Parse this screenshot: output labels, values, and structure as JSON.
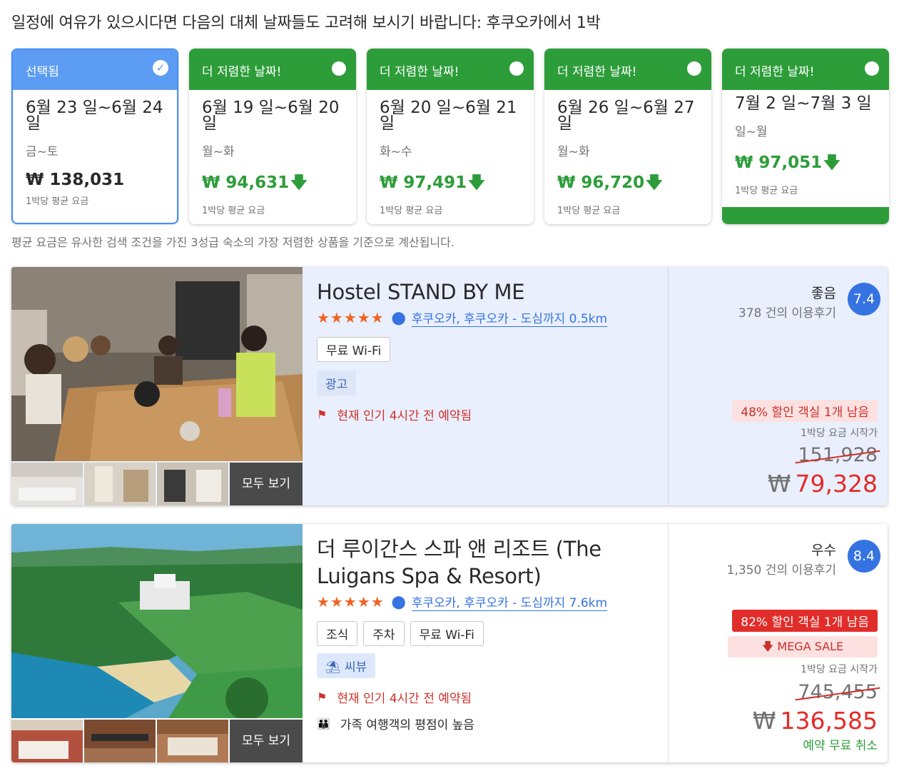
{
  "headline": "일정에 여유가 있으시다면 다음의 대체 날짜들도 고려해 보시기 바랍니다: 후쿠오카에서 1박",
  "date_cards": [
    {
      "head": "선택됨",
      "dates": "6월 23 일~6월 24 일",
      "dow": "금~토",
      "price": "₩ 138,031",
      "avg": "1박당 평균 요금"
    },
    {
      "head": "더 저렴한 날짜!",
      "dates": "6월 19 일~6월 20 일",
      "dow": "월~화",
      "price": "₩ 94,631",
      "avg": "1박당 평균 요금"
    },
    {
      "head": "더 저렴한 날짜!",
      "dates": "6월 20 일~6월 21 일",
      "dow": "화~수",
      "price": "₩ 97,491",
      "avg": "1박당 평균 요금"
    },
    {
      "head": "더 저렴한 날짜!",
      "dates": "6월 26 일~6월 27 일",
      "dow": "월~화",
      "price": "₩ 96,720",
      "avg": "1박당 평균 요금"
    },
    {
      "head": "더 저렴한 날짜!",
      "dates": "7월 2 일~7월 3 일",
      "dow": "일~월",
      "price": "₩ 97,051",
      "avg": "1박당 평균 요금"
    }
  ],
  "footnote": "평균 요금은 유사한 검색 조건을 가진 3성급 숙소의 가장 저렴한 상품을 기준으로 계산됩니다.",
  "see_all": "모두 보기",
  "hotels": [
    {
      "name": "Hostel STAND BY ME",
      "stars": "★★★★★",
      "location": "후쿠오카, 후쿠오카 - 도심까지 0.5km",
      "amenities": [
        "무료 Wi-Fi"
      ],
      "ad": "광고",
      "urgency": "현재 인기 4시간 전 예약됨",
      "rating_label": "좋음",
      "reviews": "378 건의 이용후기",
      "score": "7.4",
      "discount": "48% 할인 객실 1개 남음",
      "from_label": "1박당 요금 시작가",
      "old_price": "151,928",
      "currency": "₩",
      "new_price": "79,328"
    },
    {
      "name": "더 루이간스 스파 앤 리조트 (The Luigans Spa & Resort)",
      "stars": "★★★★★",
      "location": "후쿠오카, 후쿠오카 - 도심까지 7.6km",
      "amenities": [
        "조식",
        "주차",
        "무료 Wi-Fi"
      ],
      "view": "씨뷰",
      "urgency": "현재 인기 4시간 전 예약됨",
      "family": "가족 여행객의 평점이 높음",
      "rating_label": "우수",
      "reviews": "1,350 건의 이용후기",
      "score": "8.4",
      "discount": "82% 할인 객실 1개 남음",
      "mega_sale": "MEGA SALE",
      "from_label": "1박당 요금 시작가",
      "old_price": "745,455",
      "currency": "₩",
      "new_price": "136,585",
      "free_cancel": "예약 무료 취소"
    }
  ],
  "icons": {
    "check": "check-icon",
    "circle": "radio-circle-icon",
    "arrow_down": "arrow-down-icon",
    "pin": "map-pin-icon",
    "flag": "flag-icon",
    "beach": "beach-umbrella-icon",
    "family": "family-icon"
  },
  "colors": {
    "green": "#2d9d3a",
    "blue": "#3573e3",
    "red": "#e12d2a",
    "selected_head": "#5c9cf3"
  }
}
